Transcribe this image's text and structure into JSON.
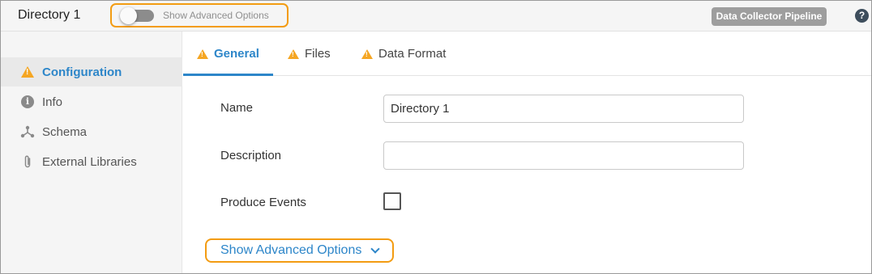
{
  "header": {
    "stage_title": "Directory 1",
    "advanced_toggle_label": "Show Advanced Options",
    "advanced_toggle_on": false,
    "pipeline_badge": "Data Collector Pipeline",
    "help_icon": "?"
  },
  "sidebar": {
    "items": [
      {
        "label": "Configuration",
        "icon": "warning-icon",
        "active": true
      },
      {
        "label": "Info",
        "icon": "info-icon",
        "active": false
      },
      {
        "label": "Schema",
        "icon": "schema-icon",
        "active": false
      },
      {
        "label": "External Libraries",
        "icon": "paperclip-icon",
        "active": false
      }
    ]
  },
  "tabs": [
    {
      "label": "General",
      "icon": "warning-icon",
      "active": true
    },
    {
      "label": "Files",
      "icon": "warning-icon",
      "active": false
    },
    {
      "label": "Data Format",
      "icon": "warning-icon",
      "active": false
    }
  ],
  "form": {
    "name_label": "Name",
    "name_value": "Directory 1",
    "description_label": "Description",
    "description_value": "",
    "produce_events_label": "Produce Events",
    "produce_events_checked": false,
    "advanced_link": "Show Advanced Options"
  },
  "colors": {
    "accent": "#2d86c9",
    "warning": "#f5a623",
    "highlight": "#f39c12"
  }
}
